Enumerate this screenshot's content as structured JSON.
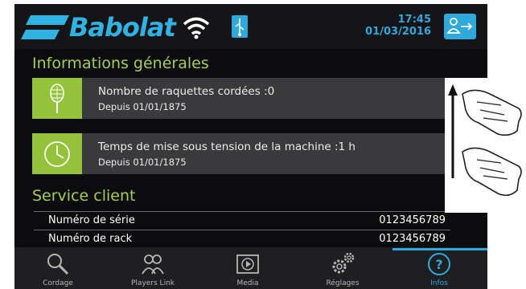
{
  "header": {
    "brand": "Babolat",
    "time": "17:45",
    "date": "01/03/2016",
    "icons": [
      "babolat-logo-mark",
      "wifi-icon",
      "usb-icon",
      "logout-icon"
    ]
  },
  "informations": {
    "title": "Informations générales",
    "cards": [
      {
        "icon": "racket-icon",
        "main": "Nombre de raquettes cordées :0",
        "sub": "Depuis 01/01/1875"
      },
      {
        "icon": "clock-icon",
        "main": "Temps de mise sous tension de la machine :1 h",
        "sub": "Depuis 01/01/1875"
      }
    ]
  },
  "service": {
    "title": "Service client",
    "rows": [
      {
        "label": "Numéro de série",
        "value": "0123456789"
      },
      {
        "label": "Numéro de rack",
        "value": "0123456789"
      }
    ]
  },
  "nav": {
    "items": [
      {
        "label": "Cordage",
        "icon": "search-icon"
      },
      {
        "label": "Players Link",
        "icon": "players-icon"
      },
      {
        "label": "Media",
        "icon": "media-play-icon"
      },
      {
        "label": "Réglages",
        "icon": "settings-gears-icon"
      },
      {
        "label": "Infos",
        "icon": "info-icon",
        "active": true
      }
    ]
  },
  "colors": {
    "accent_blue": "#2fa8dc",
    "accent_green": "#94c23b",
    "background": "#0c0c0e",
    "card": "#3a3a3c"
  },
  "gesture_icon": "two-finger-swipe-up-icon"
}
